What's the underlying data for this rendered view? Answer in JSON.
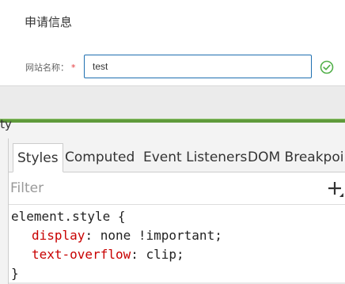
{
  "form": {
    "title": "申请信息",
    "field_label": "网站名称：",
    "required_mark": "*",
    "field_value": "test",
    "valid_icon": "check-circle-icon",
    "valid_color": "#52b04a",
    "input_border_color": "#1e6fb0"
  },
  "devtools": {
    "cutoff_label": "ity",
    "tabs": [
      {
        "label": "Styles",
        "active": true
      },
      {
        "label": "Computed",
        "active": false
      },
      {
        "label": "Event Listeners",
        "active": false
      },
      {
        "label": "DOM Breakpoints",
        "active": false
      }
    ],
    "filter_placeholder": "Filter",
    "add_rule_icon": "plus-icon",
    "rule": {
      "selector": "element.style {",
      "declarations": [
        {
          "property": "display",
          "value": "none !important;"
        },
        {
          "property": "text-overflow",
          "value": "clip;"
        }
      ],
      "closing": "}"
    },
    "property_color": "#c80000"
  }
}
